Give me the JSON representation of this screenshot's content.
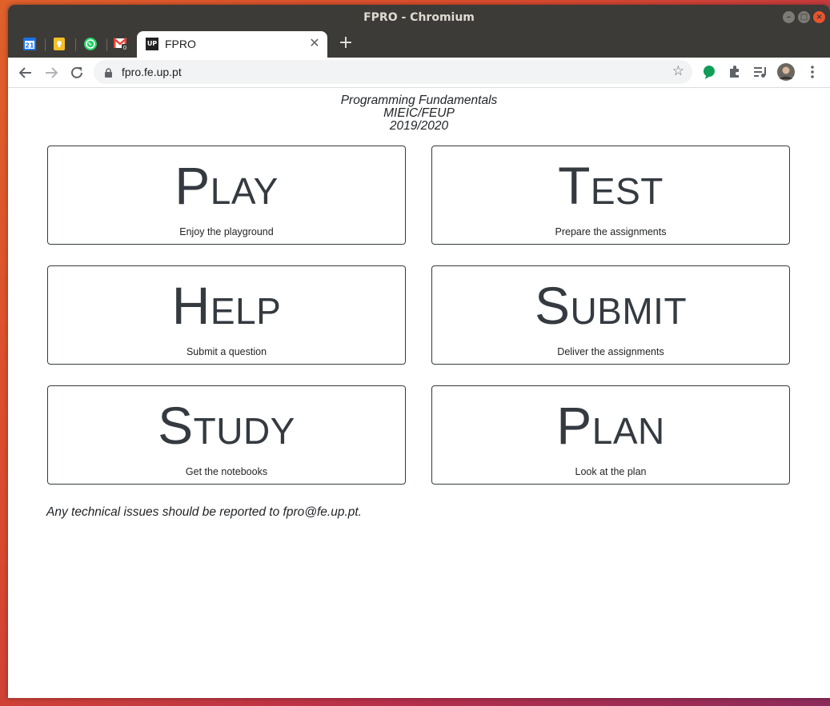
{
  "window": {
    "title": "FPRO - Chromium",
    "controls": [
      "minimize-icon",
      "maximize-icon",
      "close-icon"
    ]
  },
  "tabs": {
    "pinned": [
      {
        "name": "calendar",
        "label": "21",
        "color": "#1a73e8"
      },
      {
        "name": "keep",
        "label": "",
        "color": "#f6bf26"
      },
      {
        "name": "whatsapp",
        "label": "",
        "color": "#25d366"
      },
      {
        "name": "gmail",
        "label": "",
        "color": "#ea4335"
      }
    ],
    "active": {
      "title": "FPRO",
      "favicon_text": "UP"
    }
  },
  "toolbar": {
    "url": "fpro.fe.up.pt"
  },
  "page": {
    "header_line1": "Programming Fundamentals",
    "header_line2": "MIEIC/FEUP",
    "header_line3": "2019/2020",
    "cards": [
      {
        "title": "Play",
        "subtitle": "Enjoy the playground"
      },
      {
        "title": "Test",
        "subtitle": "Prepare the assignments"
      },
      {
        "title": "Help",
        "subtitle": "Submit a question"
      },
      {
        "title": "Submit",
        "subtitle": "Deliver the assignments"
      },
      {
        "title": "Study",
        "subtitle": "Get the notebooks"
      },
      {
        "title": "Plan",
        "subtitle": "Look at the plan"
      }
    ],
    "footer": "Any technical issues should be reported to fpro@fe.up.pt."
  },
  "colors": {
    "card_border": "#343a40",
    "text": "#212529",
    "titlebar": "#3c3b37"
  }
}
